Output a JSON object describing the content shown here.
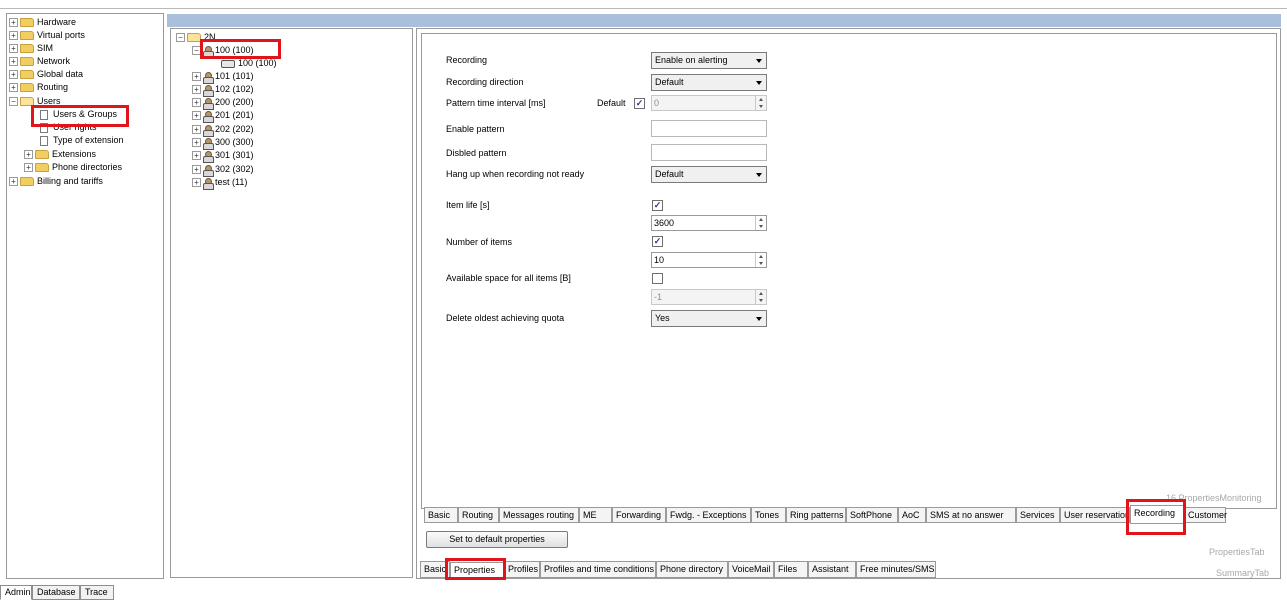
{
  "nav_tree": {
    "items": [
      {
        "label": "Hardware"
      },
      {
        "label": "Virtual ports"
      },
      {
        "label": "SIM"
      },
      {
        "label": "Network"
      },
      {
        "label": "Global data"
      },
      {
        "label": "Routing"
      },
      {
        "label": "Users"
      },
      {
        "label": "Users & Groups"
      },
      {
        "label": "User rights"
      },
      {
        "label": "Type of extension"
      },
      {
        "label": "Extensions"
      },
      {
        "label": "Phone directories"
      },
      {
        "label": "Billing and tariffs"
      }
    ]
  },
  "bottom_tabs": [
    "Admin",
    "Database",
    "Trace"
  ],
  "user_tree": {
    "root": "2N",
    "items": [
      "100 (100)",
      "100 (100)",
      "101 (101)",
      "102 (102)",
      "200 (200)",
      "201 (201)",
      "202 (202)",
      "300 (300)",
      "301 (301)",
      "302 (302)",
      "test (11)"
    ]
  },
  "form": {
    "recording_label": "Recording",
    "recording_value": "Enable on alerting",
    "direction_label": "Recording direction",
    "direction_value": "Default",
    "pattern_interval_label": "Pattern time interval [ms]",
    "pattern_default_label": "Default",
    "pattern_interval_value": "0",
    "enable_pattern_label": "Enable pattern",
    "disabled_pattern_label": "Disbled pattern",
    "hangup_label": "Hang up when recording not ready",
    "hangup_value": "Default",
    "item_life_label": "Item life [s]",
    "item_life_value": "3600",
    "num_items_label": "Number of items",
    "num_items_value": "10",
    "space_label": "Available space for all items [B]",
    "space_value": "-1",
    "delete_label": "Delete oldest achieving quota",
    "delete_value": "Yes"
  },
  "property_tabs": [
    "Basic",
    "Routing",
    "Messages routing",
    "ME",
    "Forwarding",
    "Fwdg. - Exceptions",
    "Tones",
    "Ring patterns",
    "SoftPhone",
    "AoC",
    "SMS at no answer",
    "Services",
    "User reservation",
    "Recording",
    "Customer"
  ],
  "default_button": "Set to default properties",
  "main_tabs": [
    "Basic",
    "Properties",
    "Profiles",
    "Profiles and time conditions",
    "Phone directory",
    "VoiceMail",
    "Files",
    "Assistant",
    "Free minutes/SMS"
  ],
  "faint": {
    "monitoring": "16 PropertiesMonitoring",
    "properties_tab": "PropertiesTab",
    "summary_tab": "SummaryTab"
  }
}
